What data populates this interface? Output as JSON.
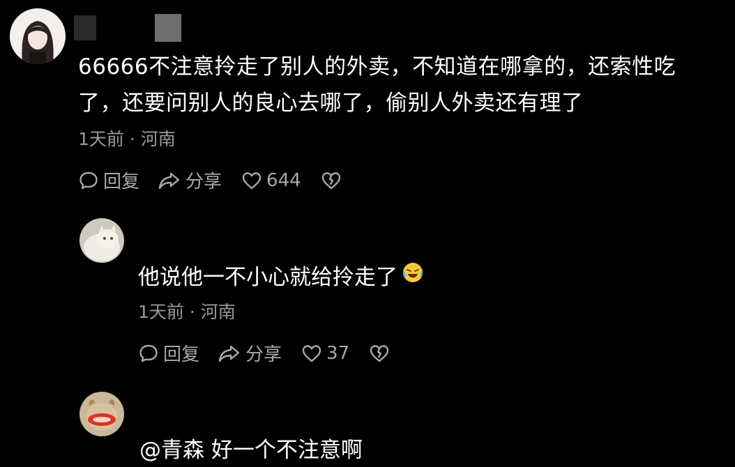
{
  "comments": [
    {
      "text_line1": "66666不注意拎走了别人的外卖，不知道在哪拿的，还索性吃",
      "text_line2": "了，还要问别人的良心去哪了，偷别人外卖还有理了",
      "meta": "1天前 · 河南",
      "reply_label": "回复",
      "share_label": "分享",
      "likes": "644"
    },
    {
      "text": "他说他一不小心就给拎走了",
      "meta": "1天前 · 河南",
      "reply_label": "回复",
      "share_label": "分享",
      "likes": "37"
    },
    {
      "text": "@青森  好一个不注意啊"
    }
  ],
  "icons": {
    "reply": "speech-bubble-icon",
    "share": "share-arrow-icon",
    "like": "heart-icon",
    "dislike": "broken-heart-icon",
    "emoji": "crying-laughing-emoji"
  },
  "colors": {
    "background": "#000000",
    "text": "#ffffff",
    "meta": "#9a9a9a",
    "action": "#a8a8a8"
  }
}
